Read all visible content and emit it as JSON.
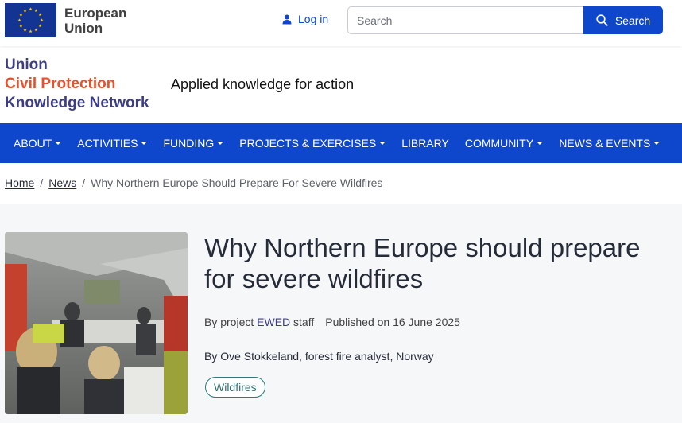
{
  "topbar": {
    "eu_name": "European\nUnion",
    "login_label": "Log in",
    "search_placeholder": "Search",
    "search_button": "Search"
  },
  "header": {
    "logo_line1": "Union",
    "logo_line2": "Civil Protection",
    "logo_line3": "Knowledge Network",
    "tagline": "Applied knowledge for action"
  },
  "nav": {
    "items": [
      {
        "label": "ABOUT",
        "dropdown": true
      },
      {
        "label": "ACTIVITIES",
        "dropdown": true
      },
      {
        "label": "FUNDING",
        "dropdown": true
      },
      {
        "label": "PROJECTS & EXERCISES",
        "dropdown": true
      },
      {
        "label": "LIBRARY",
        "dropdown": false
      },
      {
        "label": "COMMUNITY",
        "dropdown": true
      },
      {
        "label": "NEWS & EVENTS",
        "dropdown": true
      }
    ]
  },
  "breadcrumb": {
    "home": "Home",
    "news": "News",
    "current": "Why Northern Europe Should Prepare For Severe Wildfires"
  },
  "article": {
    "title": "Why Northern Europe should prepare for severe wildfires",
    "byline_prefix": "By project",
    "byline_project": "EWED",
    "byline_suffix": "staff",
    "published": "Published on 16 June 2025",
    "author": "By Ove Stokkeland, forest fire analyst, Norway",
    "tag": "Wildfires"
  },
  "colors": {
    "primary": "#0e47cb",
    "logo_blue": "#3d3d85",
    "logo_orange": "#e8512b",
    "eu_flag": "#143494",
    "eu_stars": "#ffcc00"
  }
}
